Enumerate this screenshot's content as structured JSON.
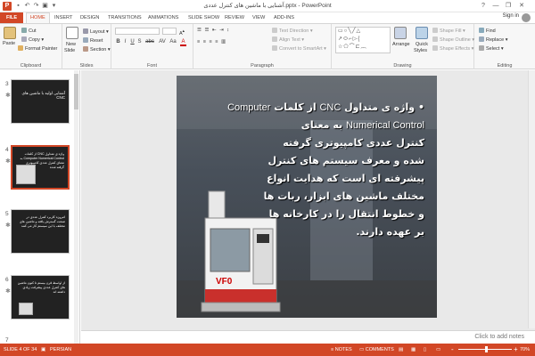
{
  "titlebar": {
    "title": "آشنایی با ماشین های کنترل عددی.pptx - PowerPoint",
    "help": "?",
    "minimize": "—",
    "restore": "❐",
    "close": "✕"
  },
  "tabs": {
    "file": "FILE",
    "items": [
      "HOME",
      "INSERT",
      "DESIGN",
      "TRANSITIONS",
      "ANIMATIONS",
      "SLIDE SHOW",
      "REVIEW",
      "VIEW",
      "ADD-INS"
    ],
    "signin": "Sign in"
  },
  "ribbon": {
    "clipboard": {
      "paste": "Paste",
      "cut": "Cut",
      "copy": "Copy",
      "format_painter": "Format Painter",
      "label": "Clipboard"
    },
    "slides": {
      "new_slide": "New",
      "new_slide_2": "Slide",
      "layout": "Layout",
      "reset": "Reset",
      "section": "Section",
      "label": "Slides"
    },
    "font": {
      "label": "Font",
      "bold": "B",
      "italic": "I",
      "underline": "U",
      "strike": "S",
      "shadow": "abc",
      "spacing": "AV",
      "case": "Aa",
      "color": "A"
    },
    "paragraph": {
      "text_direction": "Text Direction",
      "align_text": "Align Text",
      "smartart": "Convert to SmartArt",
      "label": "Paragraph"
    },
    "drawing": {
      "arrange": "Arrange",
      "quick_styles": "Quick",
      "quick_styles_2": "Styles",
      "shape_fill": "Shape Fill",
      "shape_outline": "Shape Outline",
      "shape_effects": "Shape Effects",
      "label": "Drawing"
    },
    "editing": {
      "find": "Find",
      "replace": "Replace",
      "select": "Select",
      "label": "Editing"
    }
  },
  "thumbnails": [
    {
      "num": "3",
      "text": "آشنایی اولیه با ماشین های CNC"
    },
    {
      "num": "4",
      "text": "واژه ی متداول CNC از کلمات Computer Numerical Control به معنای کنترل عددی کامپیوتری گرفته شده"
    },
    {
      "num": "5",
      "text": "امروزه کاربرد کنترل عددی در صنعت گسترش یافته و ماشین های مختلف با این سیستم کار می کنند"
    },
    {
      "num": "6",
      "text": "از اواسط قرن بیستم تا کنون ماشین های کنترل عددی پیشرفت زیادی داشته اند"
    }
  ],
  "slide": {
    "bullet": "•",
    "line1_a": "واژه ی متداول",
    "line1_b": "CNC",
    "line1_c": "از کلمات",
    "line1_d": "Computer",
    "line2_a": "Numerical Control",
    "line2_b": "به معنای",
    "line3": "کنترل عددی کامپیوتری گرفته",
    "line4": "شده و معرف سیستم های کنترل",
    "line5": "پیشرفته ای است که هدایت انواع",
    "line6": "مختلف ماشین های ابزار، ربات ها",
    "line7": "و خطوط انتقال را در کارخانه ها",
    "line8": "بر عهده دارند.",
    "machine_label": "VF0"
  },
  "notes": {
    "placeholder": "Click to add notes"
  },
  "statusbar": {
    "slide_info": "SLIDE 4 OF 34",
    "language": "PERSIAN",
    "notes": "NOTES",
    "comments": "COMMENTS",
    "zoom_minus": "-",
    "zoom_plus": "+",
    "zoom": "70%"
  },
  "colors": {
    "accent": "#d24726"
  }
}
